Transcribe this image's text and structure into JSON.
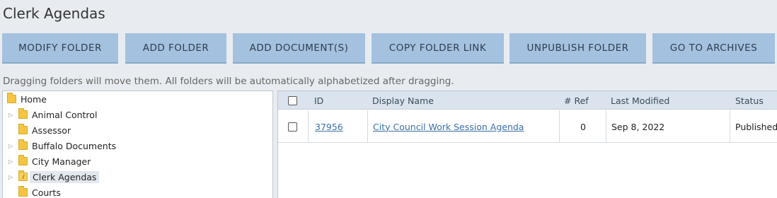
{
  "page": {
    "title": "Clerk Agendas"
  },
  "toolbar": {
    "buttons": [
      "MODIFY FOLDER",
      "ADD FOLDER",
      "ADD DOCUMENT(S)",
      "COPY FOLDER LINK",
      "UNPUBLISH FOLDER",
      "GO TO ARCHIVES"
    ]
  },
  "hint": "Dragging folders will move them. All folders will be automatically alphabetized after dragging.",
  "tree": {
    "root": "Home",
    "items": [
      {
        "label": "Animal Control",
        "expandable": true
      },
      {
        "label": "Assessor",
        "expandable": false
      },
      {
        "label": "Buffalo Documents",
        "expandable": true
      },
      {
        "label": "City Manager",
        "expandable": true
      },
      {
        "label": "Clerk Agendas",
        "expandable": true,
        "selected": true
      },
      {
        "label": "Courts",
        "expandable": false
      }
    ]
  },
  "grid": {
    "columns": [
      "ID",
      "Display Name",
      "# Ref",
      "Last Modified",
      "Status"
    ],
    "rows": [
      {
        "id": "37956",
        "display_name": "City Council Work Session Agenda",
        "ref": "0",
        "last_modified": "Sep 8, 2022",
        "status": "Published"
      }
    ]
  },
  "colors": {
    "button_bg": "#a4c1df",
    "header_bg": "#dbe4ee",
    "link": "#3a6fa8",
    "folder": "#f5c542"
  }
}
